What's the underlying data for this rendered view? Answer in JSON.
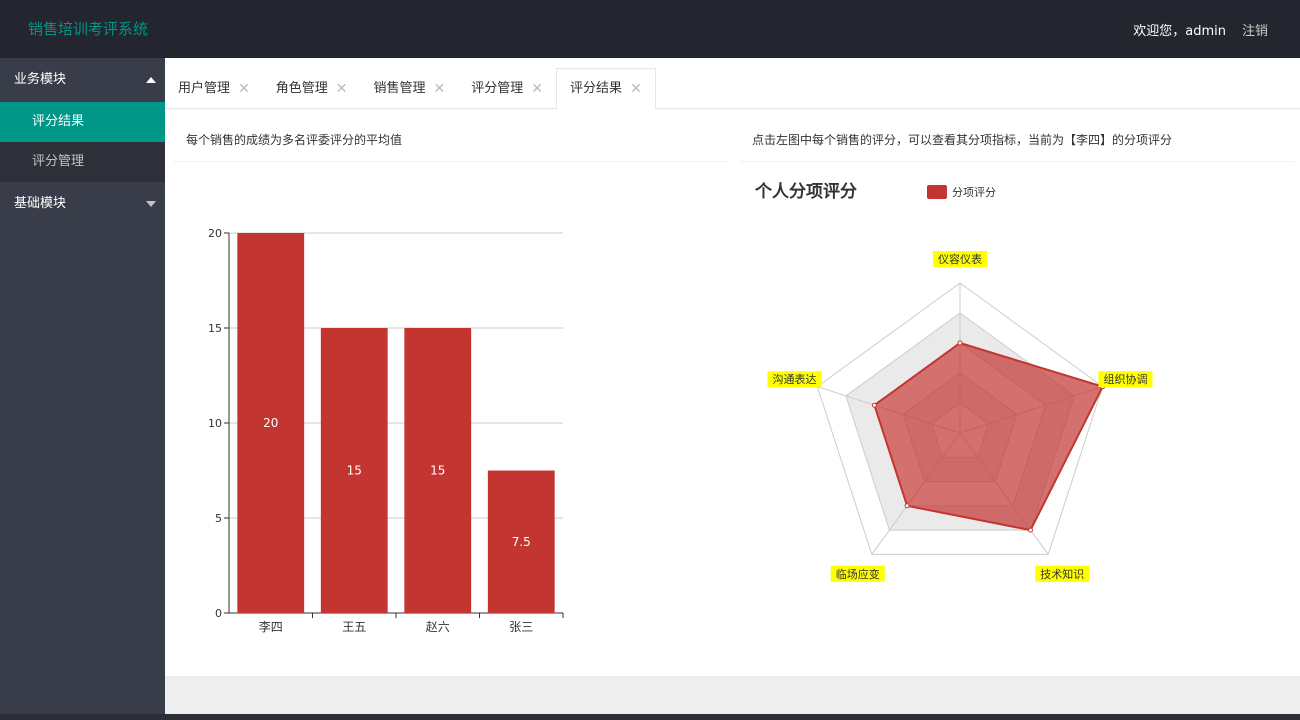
{
  "header": {
    "brand": "销售培训考评系统",
    "welcome": "欢迎您，admin",
    "logout": "注销"
  },
  "sidebar": {
    "groups": [
      {
        "label": "业务模块",
        "items": [
          "评分结果",
          "评分管理"
        ]
      },
      {
        "label": "基础模块",
        "items": []
      }
    ]
  },
  "tabs": [
    "用户管理",
    "角色管理",
    "销售管理",
    "评分管理",
    "评分结果"
  ],
  "left_panel": {
    "title": "每个销售的成绩为多名评委评分的平均值"
  },
  "right_panel": {
    "title": "点击左图中每个销售的评分，可以查看其分项指标，当前为【李四】的分项评分"
  },
  "colors": {
    "brand": "#009688",
    "bar": "#c23531",
    "label_bg": "#ffff00"
  },
  "chart_data": [
    {
      "type": "bar",
      "categories": [
        "李四",
        "王五",
        "赵六",
        "张三"
      ],
      "values": [
        20,
        15,
        15,
        7.5
      ],
      "data_labels": [
        "20",
        "15",
        "15",
        "7.5"
      ],
      "yticks": [
        "0",
        "5",
        "10",
        "15",
        "20"
      ],
      "ylim": [
        0,
        20
      ],
      "grid": true
    },
    {
      "type": "radar",
      "title": "个人分项评分",
      "legend": "分项评分",
      "legend_position": "top",
      "indicators": [
        "仪容仪表",
        "组织协调",
        "技术知识",
        "临场应变",
        "沟通表达"
      ],
      "max": 5,
      "values": [
        3,
        5,
        4,
        3,
        3
      ]
    }
  ]
}
